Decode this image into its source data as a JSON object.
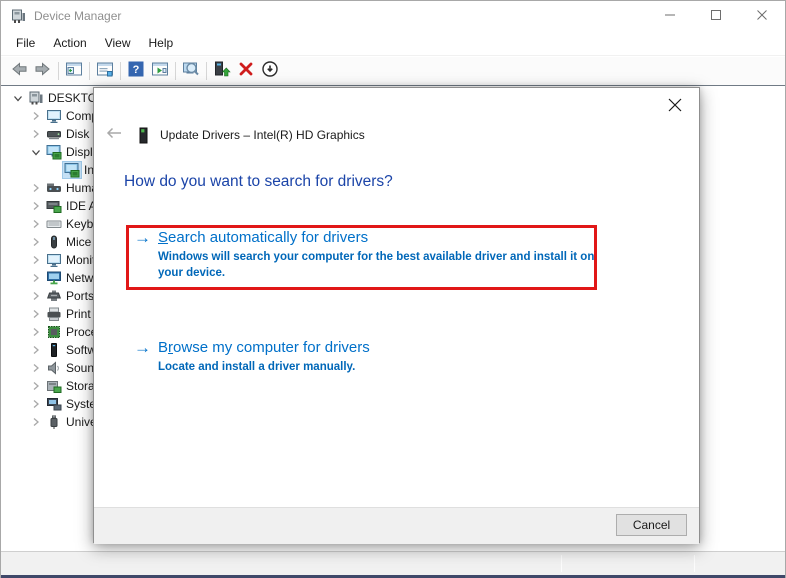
{
  "titlebar": {
    "title": "Device Manager"
  },
  "menubar": {
    "items": [
      "File",
      "Action",
      "View",
      "Help"
    ]
  },
  "toolbar": {
    "items": [
      {
        "icon": "back"
      },
      {
        "icon": "forward"
      },
      {
        "sep": true
      },
      {
        "icon": "console-tree"
      },
      {
        "sep": true
      },
      {
        "icon": "properties"
      },
      {
        "sep": true
      },
      {
        "icon": "help"
      },
      {
        "icon": "action-pane"
      },
      {
        "sep": true
      },
      {
        "icon": "scan-hardware"
      },
      {
        "sep": true
      },
      {
        "icon": "update-driver"
      },
      {
        "icon": "uninstall"
      },
      {
        "icon": "disable-device"
      }
    ]
  },
  "tree": {
    "items": [
      {
        "label": "DESKTOP",
        "icon": "computer",
        "chevron": "expanded",
        "indent": 0
      },
      {
        "label": "Computer",
        "icon": "monitor",
        "chevron": "collapsed",
        "indent": 1
      },
      {
        "label": "Disk drives",
        "icon": "disk",
        "chevron": "collapsed",
        "indent": 1
      },
      {
        "label": "Display adapters",
        "icon": "display",
        "chevron": "expanded",
        "indent": 1
      },
      {
        "label": "Intel(R) HD Graphics",
        "icon": "display",
        "chevron": "none",
        "indent": 2,
        "selected": true
      },
      {
        "label": "Human Interface Devices",
        "icon": "hid",
        "chevron": "collapsed",
        "indent": 1
      },
      {
        "label": "IDE ATA/ATAPI controllers",
        "icon": "ide",
        "chevron": "collapsed",
        "indent": 1
      },
      {
        "label": "Keyboards",
        "icon": "keyboard",
        "chevron": "collapsed",
        "indent": 1
      },
      {
        "label": "Mice and other pointing devices",
        "icon": "mouse",
        "chevron": "collapsed",
        "indent": 1
      },
      {
        "label": "Monitors",
        "icon": "monitor",
        "chevron": "collapsed",
        "indent": 1
      },
      {
        "label": "Network adapters",
        "icon": "network",
        "chevron": "collapsed",
        "indent": 1
      },
      {
        "label": "Ports (COM & LPT)",
        "icon": "port",
        "chevron": "collapsed",
        "indent": 1
      },
      {
        "label": "Print queues",
        "icon": "printer",
        "chevron": "collapsed",
        "indent": 1
      },
      {
        "label": "Processors",
        "icon": "cpu",
        "chevron": "collapsed",
        "indent": 1
      },
      {
        "label": "Software devices",
        "icon": "software",
        "chevron": "collapsed",
        "indent": 1
      },
      {
        "label": "Sound, video and game controllers",
        "icon": "speaker",
        "chevron": "collapsed",
        "indent": 1
      },
      {
        "label": "Storage controllers",
        "icon": "storage",
        "chevron": "collapsed",
        "indent": 1
      },
      {
        "label": "System devices",
        "icon": "system",
        "chevron": "collapsed",
        "indent": 1
      },
      {
        "label": "Universal Serial Bus controllers",
        "icon": "usb",
        "chevron": "collapsed",
        "indent": 1
      }
    ]
  },
  "dialog": {
    "title": "Update Drivers – Intel(R) HD Graphics",
    "heading": "How do you want to search for drivers?",
    "options": [
      {
        "title_pre": "",
        "title_accel": "S",
        "title_rest": "earch automatically for drivers",
        "description": "Windows will search your computer for the best available driver and install it on your device.",
        "highlighted": true
      },
      {
        "title_pre": "B",
        "title_accel": "r",
        "title_rest": "owse my computer for drivers",
        "description": "Locate and install a driver manually.",
        "highlighted": false
      }
    ],
    "cancel_label": "Cancel"
  },
  "colors": {
    "heading_blue": "#1b44a8",
    "link_blue": "#0070c9",
    "description_blue": "#0067b8",
    "highlight_red": "#e11717",
    "bottom_strip": "#3f4869"
  }
}
